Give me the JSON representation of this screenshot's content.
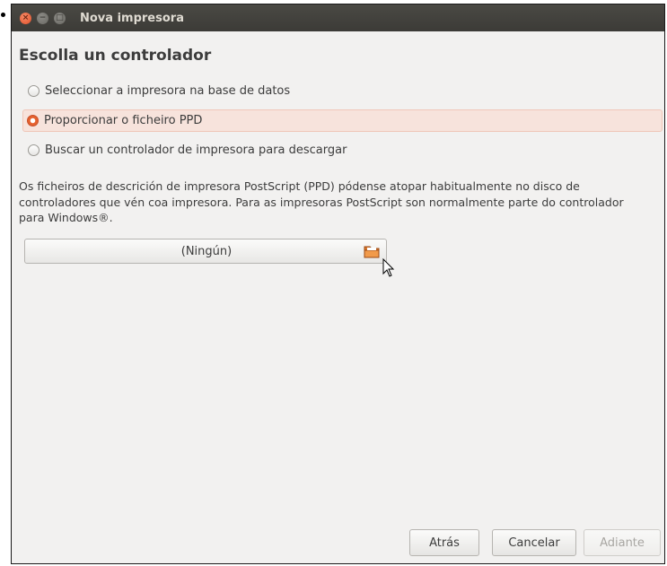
{
  "window": {
    "title": "Nova impresora"
  },
  "page": {
    "heading": "Escolla un controlador"
  },
  "options": [
    {
      "label": "Seleccionar a impresora na base de datos",
      "checked": false
    },
    {
      "label": "Proporcionar o ficheiro PPD",
      "checked": true
    },
    {
      "label": "Buscar un controlador de impresora para descargar",
      "checked": false
    }
  ],
  "description": "Os ficheiros de descrición de impresora PostScript (PPD) pódense atopar habitualmente no disco de controladores que vén coa impresora. Para as impresoras PostScript son normalmente parte do controlador para Windows®.",
  "file_chooser": {
    "value": "(Ningún)",
    "icon": "folder-icon"
  },
  "buttons": {
    "back": "Atrás",
    "cancel": "Cancelar",
    "forward": "Adiante"
  },
  "colors": {
    "titlebar": "#3c3b37",
    "accent": "#e5612f",
    "selected_row": "#f7e3dc",
    "background": "#f2f1f0"
  }
}
